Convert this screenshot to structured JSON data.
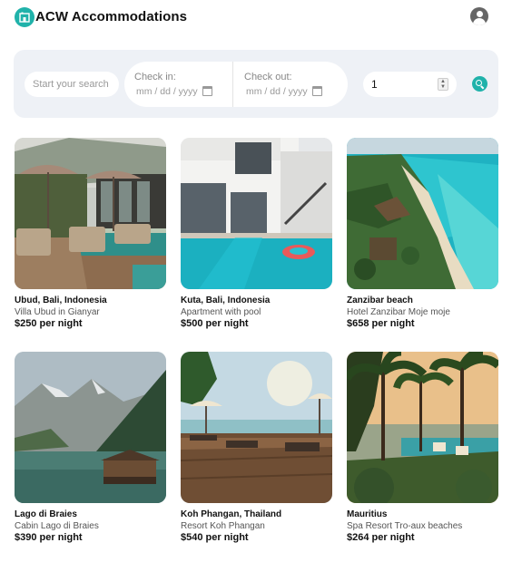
{
  "header": {
    "brand": "ACW Accommodations",
    "logo_icon": "home-logo-icon",
    "account_icon": "user-account-icon"
  },
  "search": {
    "placeholder": "Start your search",
    "checkin_label": "Check in:",
    "checkin_value": "mm / dd / yyyy",
    "checkout_label": "Check out:",
    "checkout_value": "mm / dd / yyyy",
    "guests_value": "1",
    "search_icon": "search-icon"
  },
  "colors": {
    "accent": "#20b2aa",
    "search_bg": "#eef1f6"
  },
  "listings": [
    {
      "title": "Ubud, Bali, Indonesia",
      "subtitle": "Villa Ubud in Gianyar",
      "price": "$250",
      "per": " per night"
    },
    {
      "title": "Kuta, Bali, Indonesia",
      "subtitle": "Apartment with pool",
      "price": "$500",
      "per": " per night"
    },
    {
      "title": "Zanzibar beach",
      "subtitle": "Hotel Zanzibar Moje moje",
      "price": "$658",
      "per": " per night"
    },
    {
      "title": "Lago di Braies",
      "subtitle": "Cabin Lago di Braies",
      "price": "$390",
      "per": " per night"
    },
    {
      "title": "Koh Phangan, Thailand",
      "subtitle": "Resort Koh Phangan",
      "price": "$540",
      "per": " per night"
    },
    {
      "title": "Mauritius",
      "subtitle": "Spa Resort Tro-aux beaches",
      "price": "$264",
      "per": " per night"
    }
  ]
}
